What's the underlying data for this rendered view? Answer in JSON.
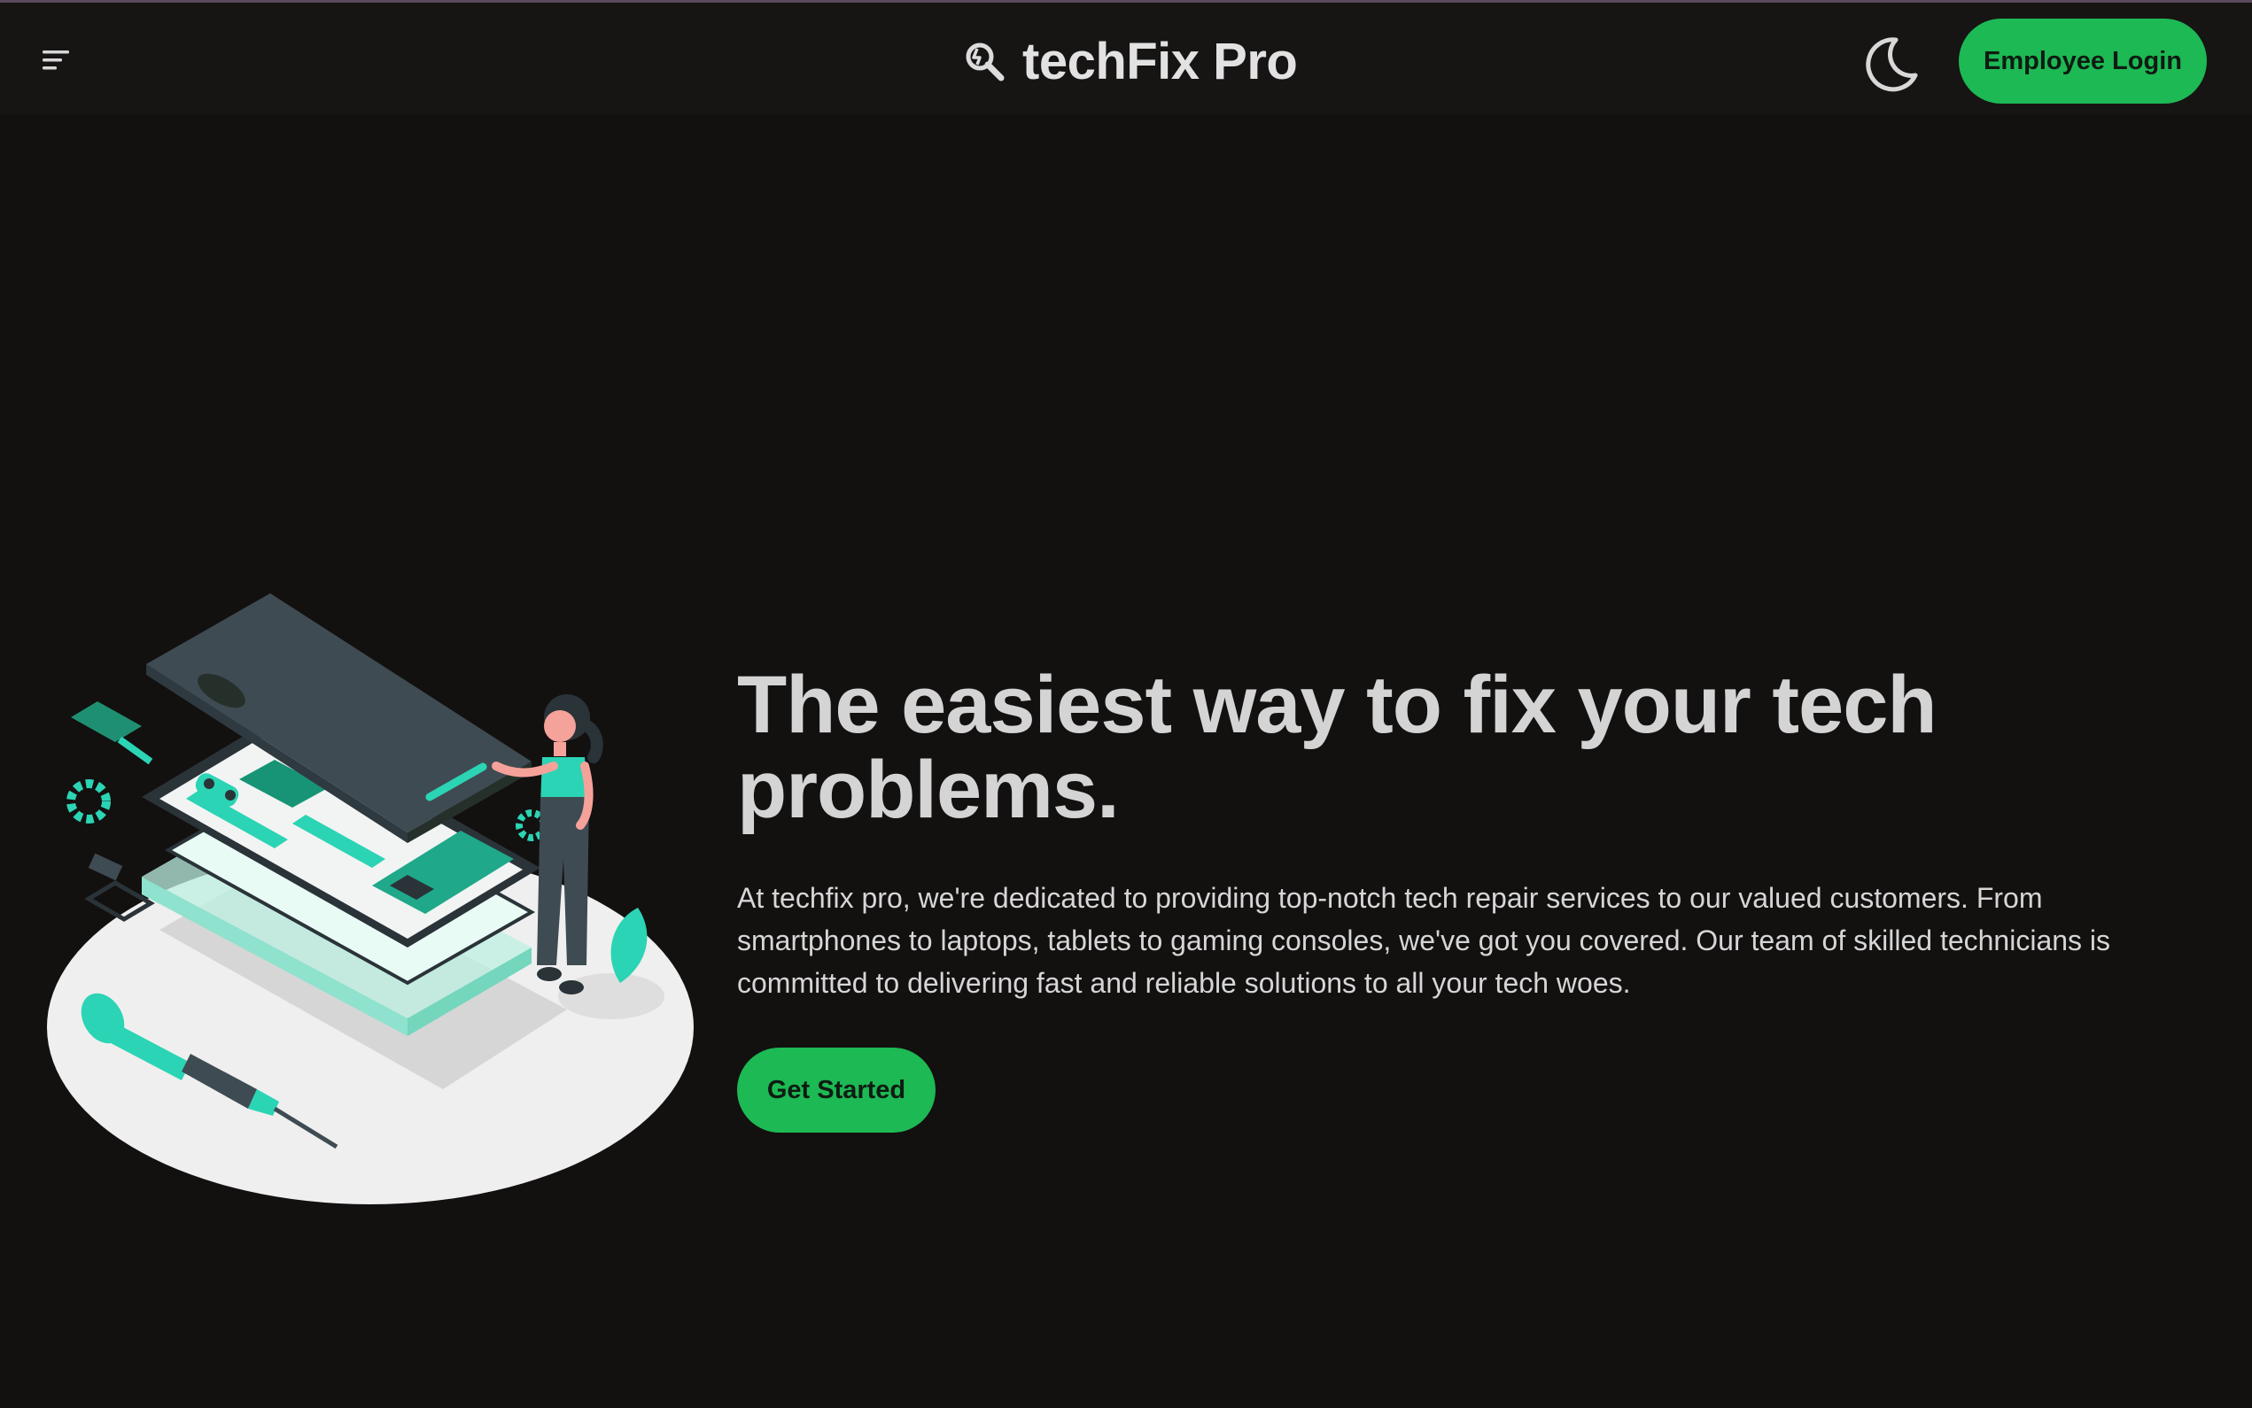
{
  "header": {
    "menu_icon": "menu-icon",
    "brand_icon": "wrench-search-icon",
    "brand_name": "techFix Pro",
    "theme_toggle_icon": "moon-icon",
    "login_label": "Employee Login"
  },
  "hero": {
    "illustration": "phone-repair-illustration",
    "headline": "The easiest way to fix your tech problems.",
    "description": "At techfix pro, we're dedicated to providing top-notch tech repair services to our valued customers. From smartphones to laptops, tablets to gaming consoles, we've got you covered. Our team of skilled technicians is committed to delivering fast and reliable solutions to all your tech woes.",
    "cta_label": "Get Started"
  },
  "colors": {
    "background": "#131010",
    "navbar": "#171414",
    "accent": "#1db954",
    "illustration_teal": "#2bd4b4",
    "text": "#d4d4d4"
  }
}
